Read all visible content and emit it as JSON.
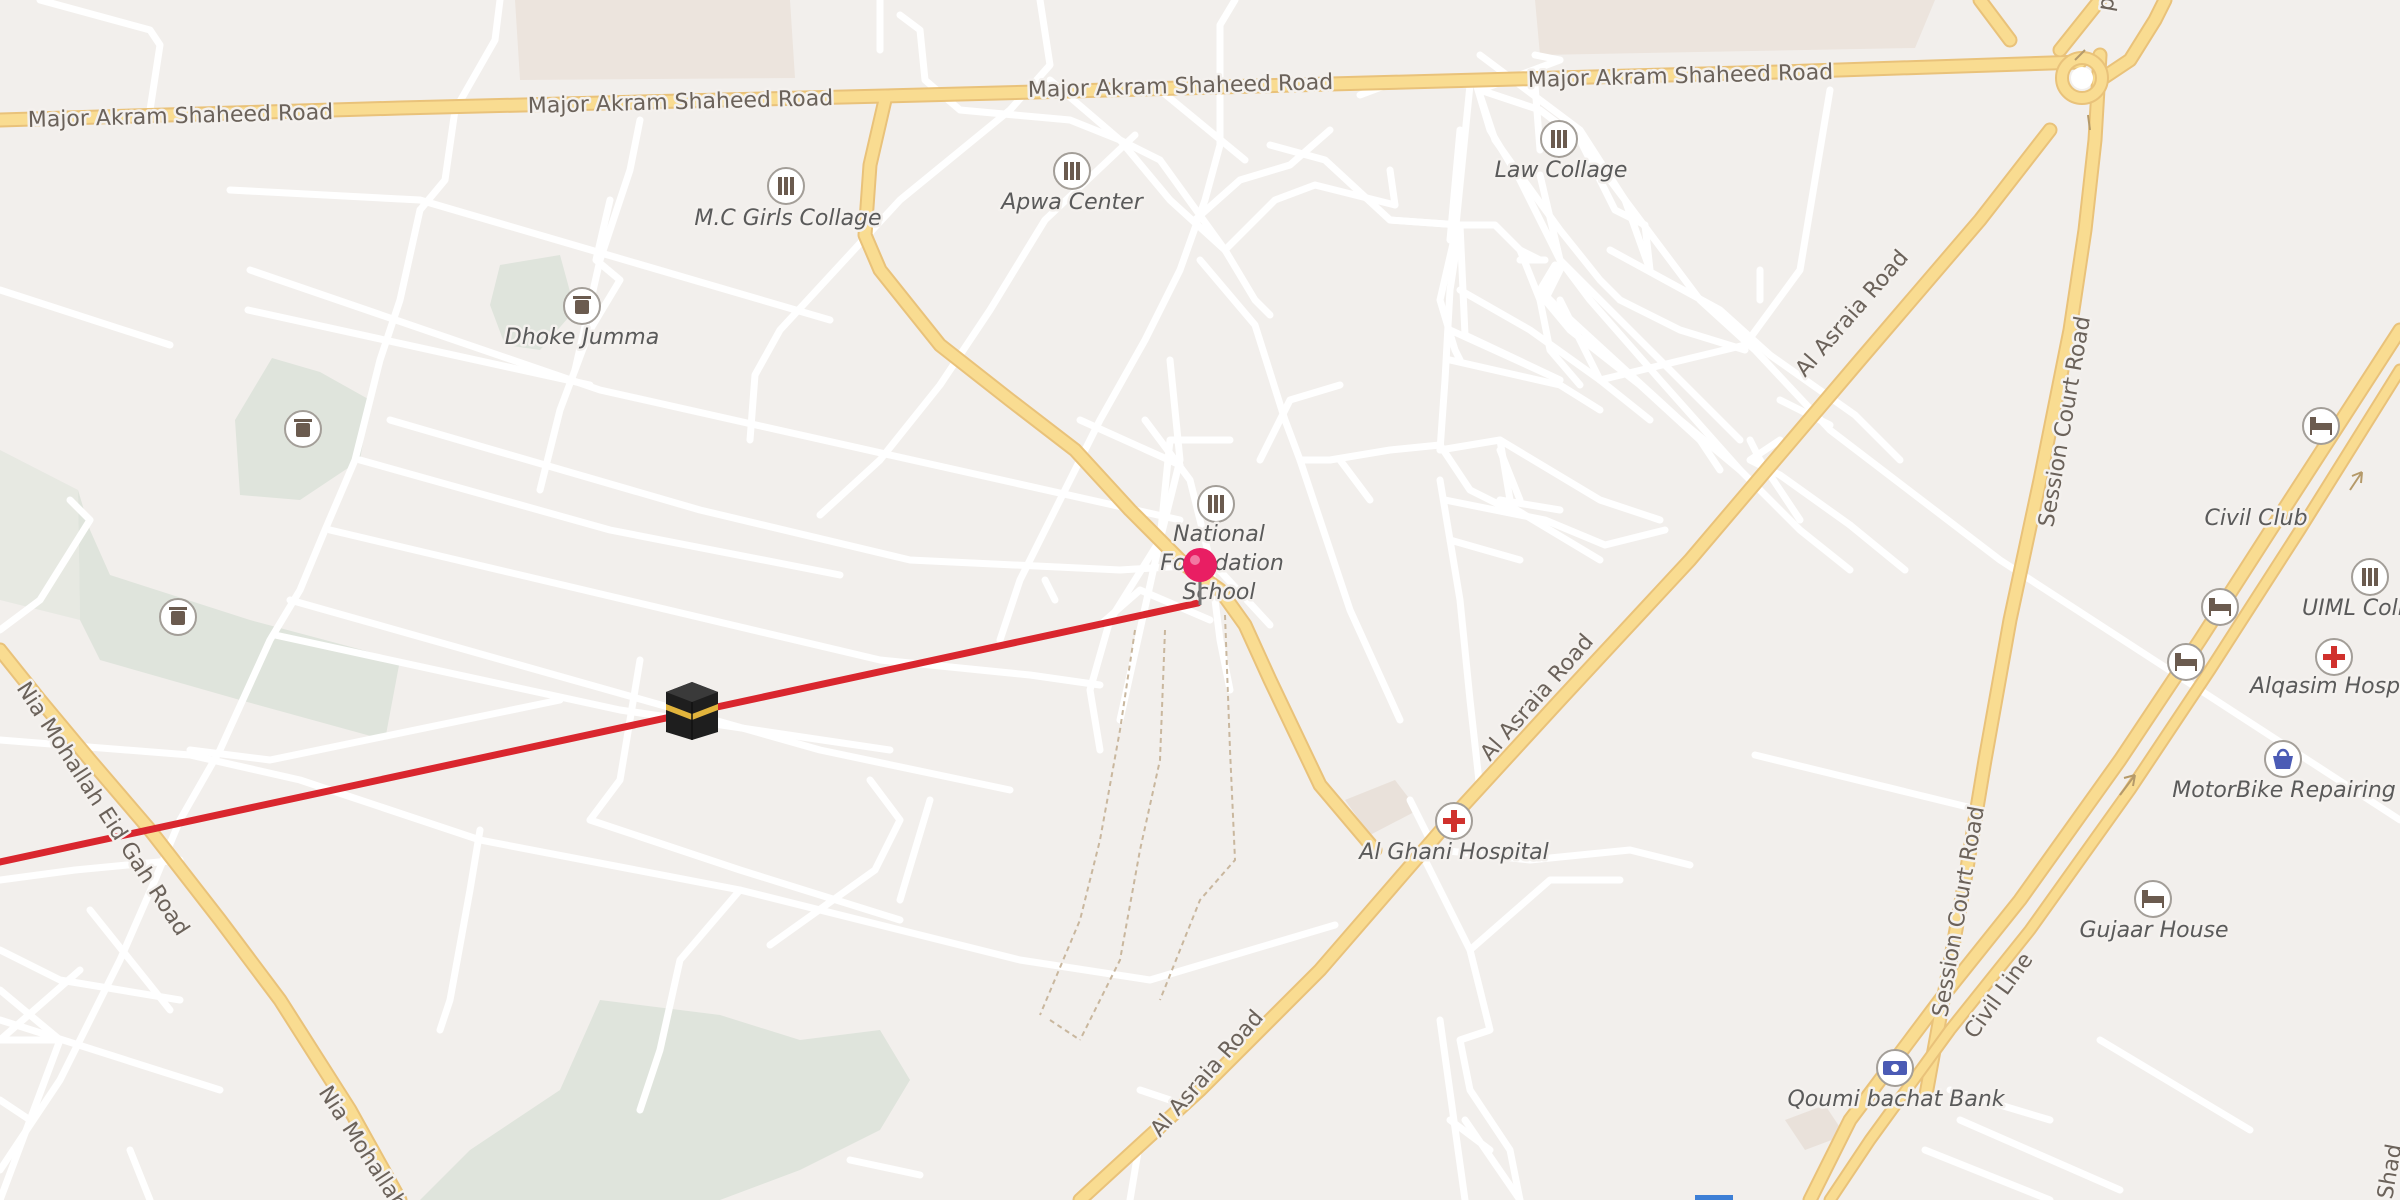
{
  "map": {
    "roads": {
      "major_akram_1": "Major Akram Shaheed Road",
      "major_akram_2": "Major Akram Shaheed Road",
      "major_akram_3": "Major Akram Shaheed Road",
      "major_akram_4": "Major Akram Shaheed Road",
      "al_asraia_1": "Al Asraia Road",
      "al_asraia_2": "Al Asraia Road",
      "al_asraia_3": "Al Asraia Road",
      "session_court_1": "Session Court Road",
      "session_court_2": "Session Court Road",
      "civil_line": "Civil Line",
      "nia_mohallah_1": "Nia Mohallah Eid Gah Road",
      "nia_mohallah_2": "Nia Mohallah",
      "edge_1": "Shad",
      "edge_2": "p"
    },
    "pois": [
      {
        "id": "mc-girls",
        "label": "M.C Girls Collage",
        "icon": "school-icon"
      },
      {
        "id": "apwa",
        "label": "Apwa Center",
        "icon": "school-icon"
      },
      {
        "id": "law",
        "label": "Law Collage",
        "icon": "school-icon"
      },
      {
        "id": "dhoke",
        "label": "Dhoke Jumma",
        "icon": "cemetery-icon"
      },
      {
        "id": "nfs-1",
        "label": "National",
        "icon": "school-icon"
      },
      {
        "id": "nfs-2",
        "label": "Foundation",
        "icon": ""
      },
      {
        "id": "nfs-3",
        "label": "School",
        "icon": ""
      },
      {
        "id": "alghani",
        "label": "Al Ghani Hospital",
        "icon": "hospital-icon"
      },
      {
        "id": "civil-club",
        "label": "Civil Club",
        "icon": "hotel-icon"
      },
      {
        "id": "uiml",
        "label": "UIML Coll",
        "icon": "school-icon"
      },
      {
        "id": "alqasim",
        "label": "Alqasim Hospi",
        "icon": "hospital-icon"
      },
      {
        "id": "motorbike",
        "label": "MotorBike Repairing",
        "icon": "shop-icon"
      },
      {
        "id": "gujaar",
        "label": "Gujaar House",
        "icon": "hotel-icon"
      },
      {
        "id": "qoumi",
        "label": "Qoumi bachat Bank",
        "icon": "bank-icon"
      }
    ],
    "markers": {
      "location_pin": "location-pin-icon",
      "kaaba": "kaaba-icon"
    },
    "colors": {
      "background": "#f2efec",
      "minor_road": "#ffffff",
      "major_road": "#f9dc91",
      "major_road_casing": "#e9c27a",
      "park": "#dfe4dc",
      "qibla_line": "#d9262e",
      "pin": "#e91e63"
    }
  }
}
